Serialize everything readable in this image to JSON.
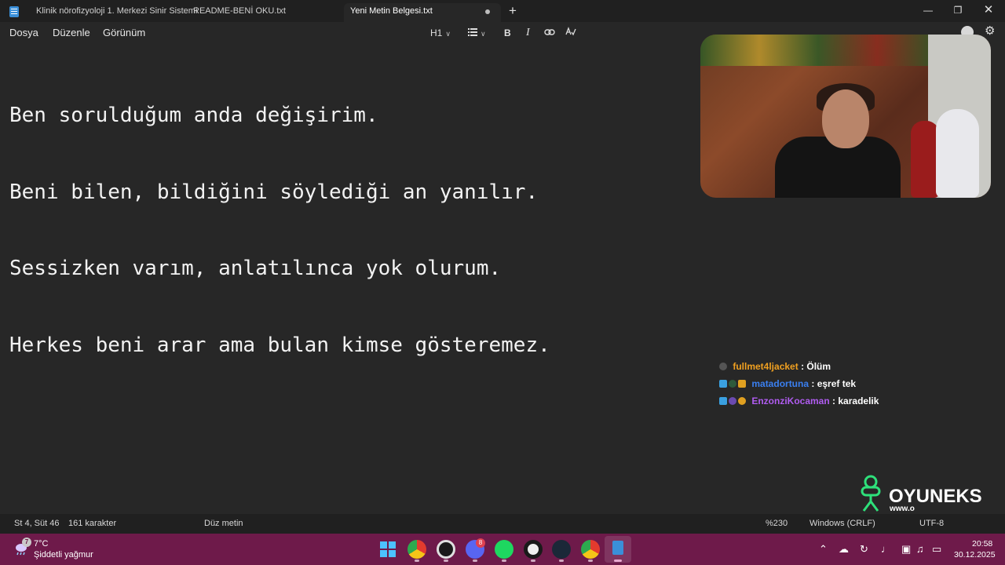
{
  "tabs": [
    {
      "label": "Klinik nörofizyoloji 1. Merkezi Sinir Sistemi"
    },
    {
      "label": "README-BENİ OKU.txt"
    },
    {
      "label": "Yeni Metin Belgesi.txt"
    }
  ],
  "menu": {
    "file": "Dosya",
    "edit": "Düzenle",
    "view": "Görünüm"
  },
  "toolbar": {
    "heading": "H1",
    "bold": "B",
    "italic": "I"
  },
  "editor": {
    "lines": [
      "Ben sorulduğum anda değişirim.",
      "Beni bilen, bildiğini söylediği an yanılır.",
      "Sessizken varım, anlatılınca yok olurum.",
      "Herkes beni arar ama bulan kimse gösteremez."
    ]
  },
  "chat": [
    {
      "user": "fullmet4ljacket",
      "message": ": Ölüm",
      "color": "#f0a020"
    },
    {
      "user": "matadortuna",
      "message": ": eşref tek",
      "color": "#3a7ff0"
    },
    {
      "user": "EnzonziKocaman",
      "message": ": karadelik",
      "color": "#b05cf0"
    }
  ],
  "logo": {
    "text": "OYUNEKS",
    "sub": "www.o"
  },
  "status": {
    "position": "St 4, Süt 46",
    "chars": "161 karakter",
    "format": "Düz metin",
    "zoom": "%230",
    "line_ending": "Windows (CRLF)",
    "encoding": "UTF-8"
  },
  "taskbar": {
    "weather_badge": "7",
    "temperature": "7°C",
    "weather": "Şiddetli yağmur",
    "time": "20:58",
    "date": "30.12.2025",
    "discord_badge": "8"
  },
  "colors": {
    "taskbar": "#6e1a4a",
    "titlebar": "#202020",
    "editor_bg": "#272727"
  }
}
